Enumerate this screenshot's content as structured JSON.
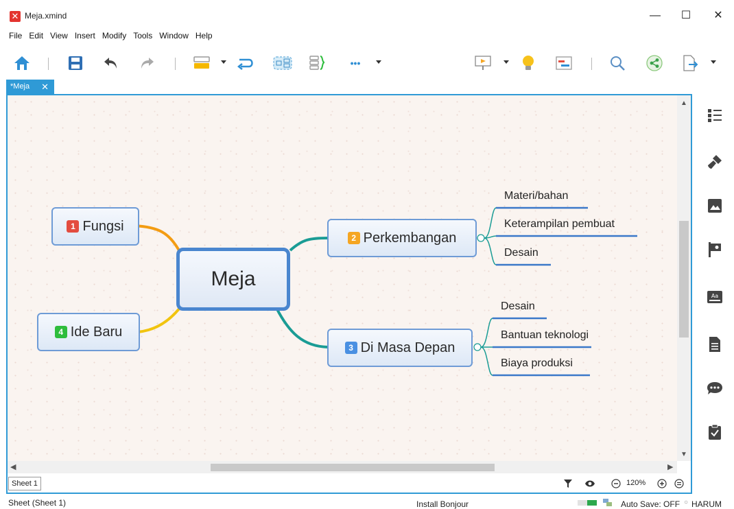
{
  "window": {
    "title": "Meja.xmind",
    "minimize": "—",
    "maximize": "☐",
    "close": "✕"
  },
  "menu": [
    "File",
    "Edit",
    "View",
    "Insert",
    "Modify",
    "Tools",
    "Window",
    "Help"
  ],
  "toolbar": {
    "icons": [
      "home-icon",
      "save-icon",
      "undo-icon",
      "redo-icon",
      "topic-icon",
      "relationship-icon",
      "boundary-icon",
      "summary-icon",
      "more-icon",
      "presentation-icon",
      "brainstorm-icon",
      "gantt-icon",
      "search-icon",
      "share-icon",
      "export-icon"
    ],
    "more_label": "•••"
  },
  "tab": {
    "label": "*Meja",
    "close": "✕"
  },
  "mindmap": {
    "central": "Meja",
    "branches": [
      {
        "badge": "1",
        "label": "Fungsi",
        "color": "#e34c3f"
      },
      {
        "badge": "2",
        "label": "Perkembangan",
        "color": "#f5a623"
      },
      {
        "badge": "3",
        "label": "Di Masa Depan",
        "color": "#4a90e2"
      },
      {
        "badge": "4",
        "label": "Ide Baru",
        "color": "#2ebd3d"
      }
    ],
    "perkembangan_children": [
      "Materi/bahan",
      "Keterampilan pembuat",
      "Desain"
    ],
    "masa_depan_children": [
      "Desain",
      "Bantuan teknologi",
      "Biaya produksi"
    ]
  },
  "sheetbar": {
    "sheet_tab": "Sheet 1",
    "zoom": "120%"
  },
  "sidebar": [
    "outline-icon",
    "format-icon",
    "image-icon",
    "marker-icon",
    "style-icon",
    "notes-icon",
    "comments-icon",
    "task-icon"
  ],
  "status": {
    "sheet": "Sheet (Sheet 1)",
    "bonjour": "Install Bonjour",
    "autosave": "Auto Save: OFF",
    "user": "HARUM"
  },
  "colors": {
    "accent": "#2f9ad6",
    "node_border": "#6e9bd6",
    "branch_fungsi": "#f39c12",
    "branch_ide": "#f1c40f",
    "branch_teal": "#1a9c95"
  }
}
